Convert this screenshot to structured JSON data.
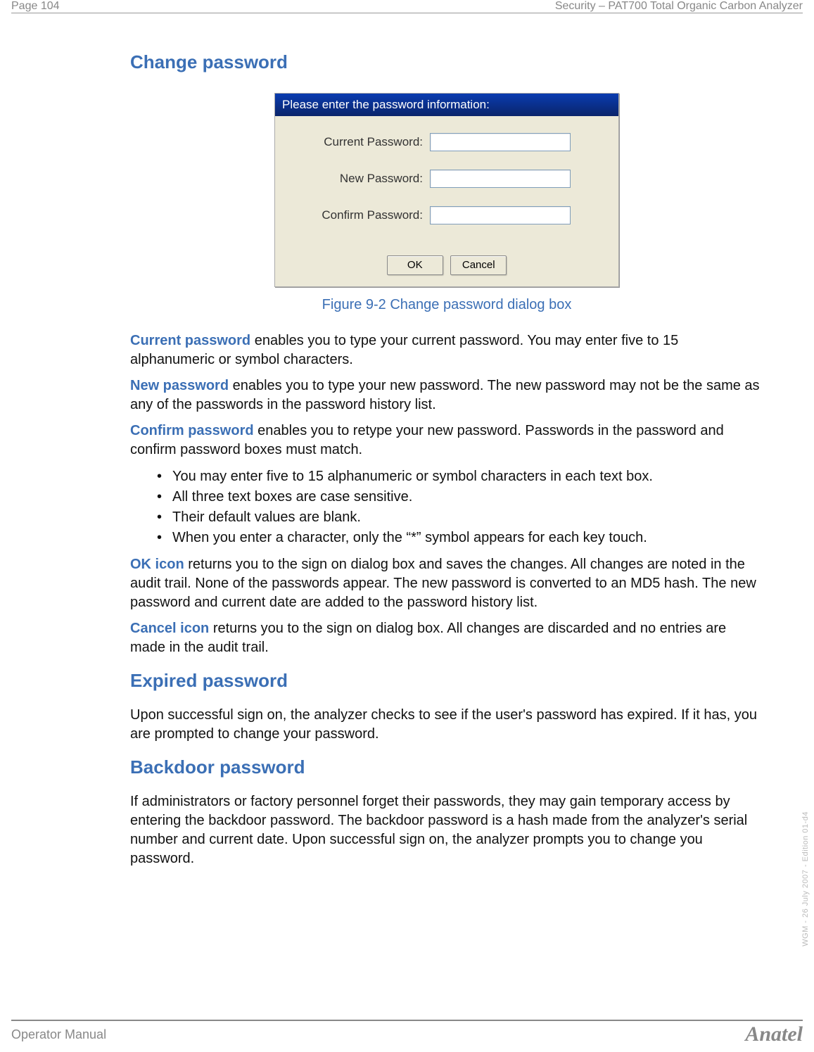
{
  "header": {
    "left": "Page 104",
    "right": "Security – PAT700 Total Organic Carbon Analyzer"
  },
  "sections": {
    "change_password": {
      "heading": "Change password",
      "dialog": {
        "title": "Please enter the password information:",
        "fields": {
          "current_label": "Current Password:",
          "new_label": "New Password:",
          "confirm_label": "Confirm Password:",
          "current_value": "",
          "new_value": "",
          "confirm_value": ""
        },
        "buttons": {
          "ok": "OK",
          "cancel": "Cancel"
        }
      },
      "figure_caption": "Figure 9-2 Change password dialog box",
      "para_current_lead": "Current password",
      "para_current_rest": " enables you to type your current password. You may enter five to 15 alphanumeric or symbol characters.",
      "para_new_lead": "New password",
      "para_new_rest": " enables you to type your new password. The new password may not be the same as any of the passwords in the password history list.",
      "para_confirm_lead": "Confirm password",
      "para_confirm_rest": " enables you to retype your new password. Passwords in the password and confirm password boxes must match.",
      "bullets": [
        "You may enter five to 15 alphanumeric or symbol characters in each text box.",
        "All three text boxes are case sensitive.",
        "Their default values are blank.",
        "When you enter a character, only the “*” symbol appears for each key touch."
      ],
      "para_ok_lead": "OK icon",
      "para_ok_rest": " returns you to the sign on dialog box and saves the changes. All changes are noted in the audit trail. None of the passwords appear. The new password is converted to an MD5 hash. The new password and current date are added to the password history list.",
      "para_cancel_lead": "Cancel icon",
      "para_cancel_rest": " returns you to the sign on dialog box. All changes are discarded and no entries are made in the audit trail."
    },
    "expired_password": {
      "heading": "Expired password",
      "body": "Upon successful sign on, the analyzer checks to see if the user's password has expired. If it has, you are prompted to change your password."
    },
    "backdoor_password": {
      "heading": "Backdoor password",
      "body": "If administrators or factory personnel forget their passwords, they may gain temporary access by entering the backdoor password. The backdoor password is a hash made from the analyzer's serial number and current date. Upon successful sign on, the analyzer prompts you to change you password."
    }
  },
  "footer": {
    "left": "Operator Manual",
    "right": "Anatel",
    "side": "WGM - 26 July 2007 - Edition 01-d4"
  }
}
